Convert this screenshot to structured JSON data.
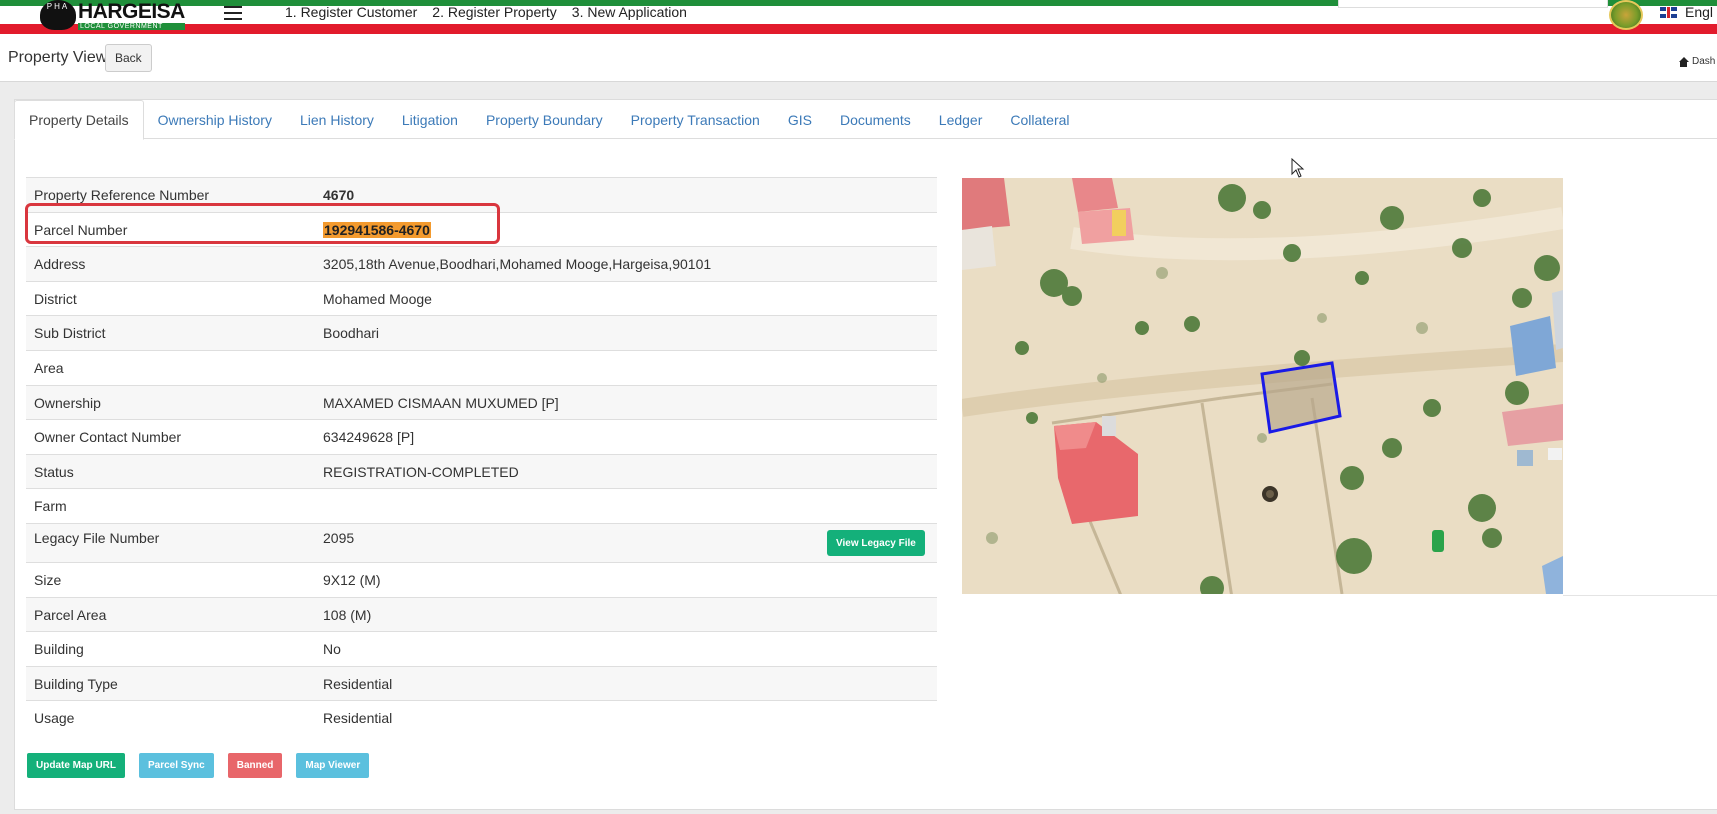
{
  "header": {
    "logo_letters": "PHA",
    "logo_title": "HARGEISA",
    "logo_subtitle": "LOCAL GOVERNMENT",
    "nav": [
      "1. Register Customer",
      "2. Register Property",
      "3. New Application"
    ],
    "language": "Engl",
    "colors": {
      "green": "#1f8f3a",
      "red": "#e21b2c"
    }
  },
  "page": {
    "title": "Property View",
    "back_label": "Back",
    "breadcrumb": "Dash"
  },
  "tabs": [
    {
      "label": "Property Details",
      "active": true
    },
    {
      "label": "Ownership History"
    },
    {
      "label": "Lien History"
    },
    {
      "label": "Litigation"
    },
    {
      "label": "Property Boundary"
    },
    {
      "label": "Property Transaction"
    },
    {
      "label": "GIS"
    },
    {
      "label": "Documents"
    },
    {
      "label": "Ledger"
    },
    {
      "label": "Collateral"
    }
  ],
  "details": [
    {
      "label": "Property Reference Number",
      "value": "4670"
    },
    {
      "label": "Parcel Number",
      "value": "192941586-4670"
    },
    {
      "label": "Address",
      "value": "3205,18th Avenue,Boodhari,Mohamed Mooge,Hargeisa,90101"
    },
    {
      "label": "District",
      "value": "Mohamed Mooge"
    },
    {
      "label": "Sub District",
      "value": "Boodhari"
    },
    {
      "label": "Area",
      "value": ""
    },
    {
      "label": "Ownership",
      "value": "MAXAMED CISMAAN MUXUMED [P]"
    },
    {
      "label": "Owner Contact Number",
      "value": "634249628 [P]"
    },
    {
      "label": "Status",
      "value": "REGISTRATION-COMPLETED"
    },
    {
      "label": "Farm",
      "value": ""
    },
    {
      "label": "Legacy File Number",
      "value": "2095"
    },
    {
      "label": "Size",
      "value": "9X12 (M)"
    },
    {
      "label": "Parcel Area",
      "value": "108 (M)"
    },
    {
      "label": "Building",
      "value": "No"
    },
    {
      "label": "Building Type",
      "value": "Residential"
    },
    {
      "label": "Usage",
      "value": "Residential"
    }
  ],
  "legacy_button": "View Legacy File",
  "actions": {
    "update_map_url": "Update Map URL",
    "parcel_sync": "Parcel Sync",
    "banned": "Banned",
    "map_viewer": "Map Viewer"
  },
  "map": {
    "parcel_outline_color": "#1a1ae6"
  }
}
